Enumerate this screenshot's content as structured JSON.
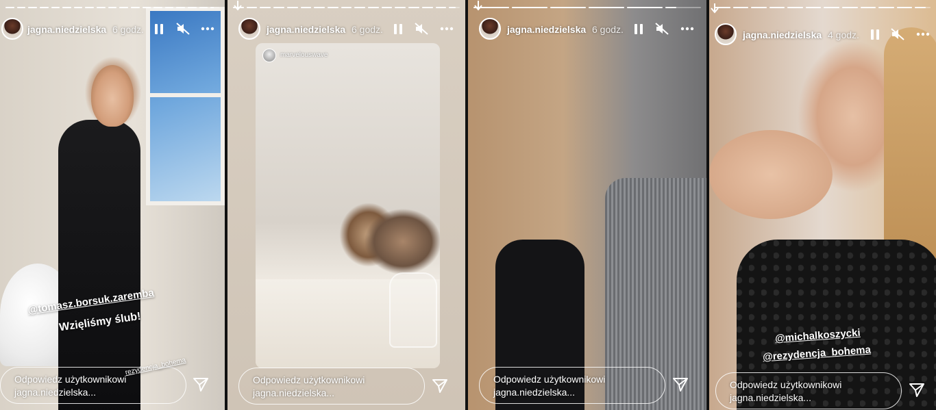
{
  "stories": [
    {
      "username": "jagna.niedzielska",
      "time": "6 godz.",
      "progress": [
        1,
        1,
        1,
        1,
        1,
        1,
        1,
        1,
        1,
        1,
        1,
        1,
        1,
        1,
        1,
        1,
        1,
        1,
        0.4
      ],
      "sticker_mention": "@tomasz.borsuk.zaremba",
      "sticker_text": "Wzięliśmy ślub!",
      "location_tag": "rezydencja_bohema",
      "reply_placeholder": "Odpowiedz użytkownikowi jagna.niedzielska..."
    },
    {
      "username": "jagna.niedzielska",
      "time": "6 godz.",
      "progress": [
        1,
        1,
        1,
        1,
        1,
        1,
        1,
        1,
        1,
        1,
        1,
        1,
        1,
        1,
        1,
        1,
        0.6
      ],
      "repost_user": "marvelouswave",
      "reply_placeholder": "Odpowiedz użytkownikowi jagna.niedzielska..."
    },
    {
      "username": "jagna.niedzielska",
      "time": "6 godz.",
      "progress": [
        1,
        1,
        1,
        1,
        1,
        0.3
      ],
      "reply_placeholder": "Odpowiedz użytkownikowi jagna.niedzielska..."
    },
    {
      "username": "jagna.niedzielska",
      "time": "4 godz.",
      "progress": [
        1,
        1,
        1,
        1,
        1,
        1,
        1,
        1,
        1,
        1,
        1,
        0.7
      ],
      "mention_1": "@michalkoszycki",
      "mention_2": "@rezydencja_bohema",
      "reply_placeholder": "Odpowiedz użytkownikowi jagna.niedzielska..."
    }
  ],
  "icons": {
    "pause": "pause-icon",
    "mute": "speaker-muted-icon",
    "more": "more-horizontal-icon",
    "send": "send-paper-plane-icon",
    "arrow": "down-arrow-icon"
  }
}
